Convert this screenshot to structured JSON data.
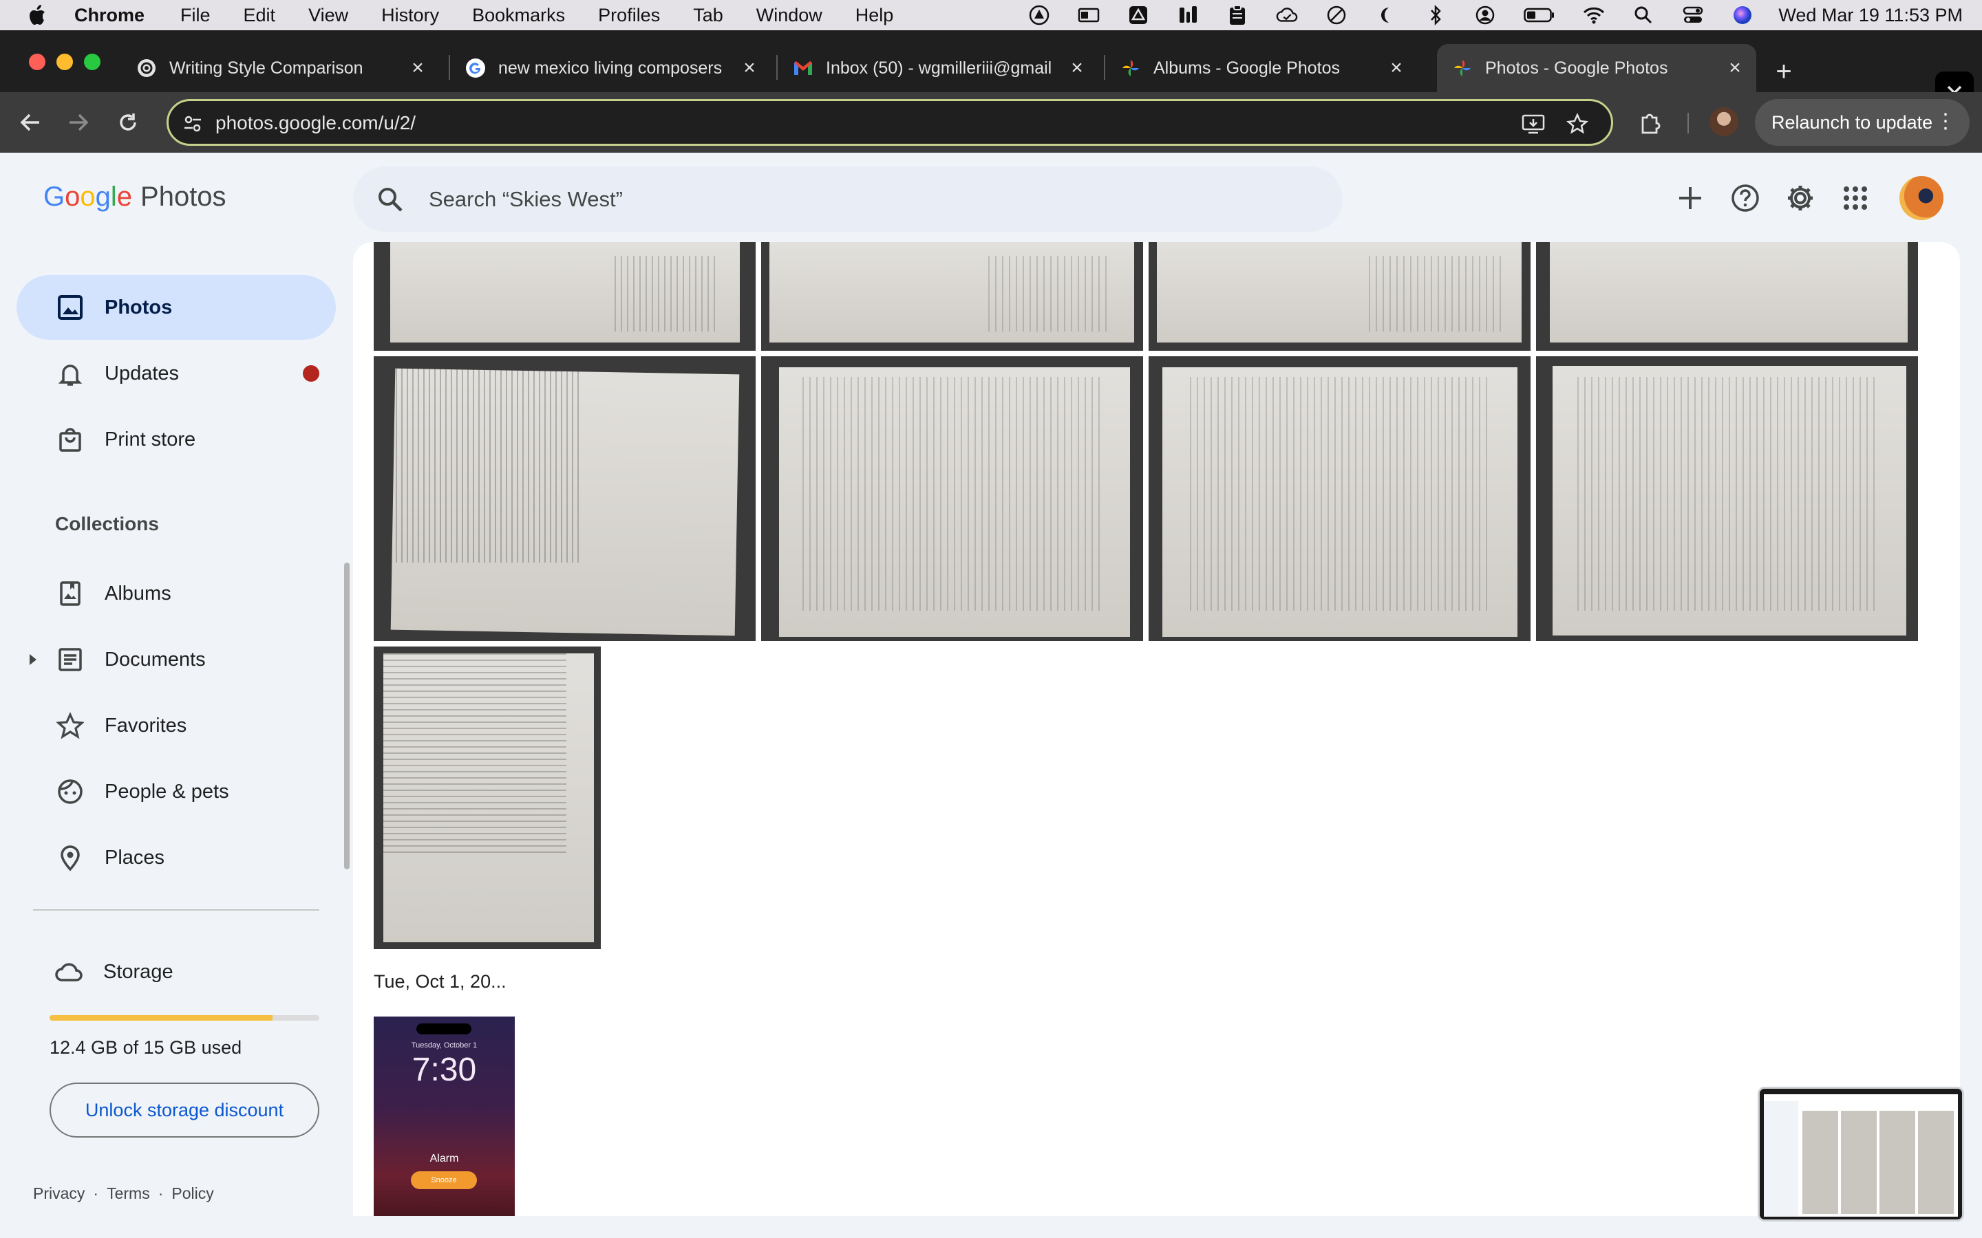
{
  "menubar": {
    "app_name": "Chrome",
    "items": [
      "File",
      "Edit",
      "View",
      "History",
      "Bookmarks",
      "Profiles",
      "Tab",
      "Window",
      "Help"
    ],
    "clock": "Wed Mar 19  11:53 PM"
  },
  "tabs": [
    {
      "title": "Writing Style Comparison",
      "icon": "chatgpt-icon"
    },
    {
      "title": "new mexico living composers",
      "icon": "google-g-icon"
    },
    {
      "title": "Inbox (50) - wgmilleriii@gmail",
      "icon": "gmail-icon"
    },
    {
      "title": "Albums - Google Photos",
      "icon": "google-photos-icon"
    },
    {
      "title": "Photos - Google Photos",
      "icon": "google-photos-icon",
      "active": true
    }
  ],
  "toolbar": {
    "url": "photos.google.com/u/2/",
    "relaunch_label": "Relaunch to update"
  },
  "app": {
    "logo_google": "Google",
    "logo_photos": "Photos",
    "search_placeholder": "Search “Skies West”"
  },
  "sidebar": {
    "items": [
      {
        "label": "Photos",
        "icon": "photo-icon",
        "active": true
      },
      {
        "label": "Updates",
        "icon": "bell-icon",
        "badge": true
      },
      {
        "label": "Print store",
        "icon": "shopping-bag-icon"
      }
    ],
    "collections_heading": "Collections",
    "collections": [
      {
        "label": "Albums",
        "icon": "album-icon"
      },
      {
        "label": "Documents",
        "icon": "document-icon",
        "expandable": true
      },
      {
        "label": "Favorites",
        "icon": "star-icon"
      },
      {
        "label": "People & pets",
        "icon": "face-icon"
      },
      {
        "label": "Places",
        "icon": "location-pin-icon"
      }
    ],
    "storage": {
      "label": "Storage",
      "used_text": "12.4 GB of 15 GB used",
      "used_fraction": 0.827,
      "unlock_label": "Unlock storage discount"
    },
    "footer": [
      "Privacy",
      "Terms",
      "Policy"
    ]
  },
  "main": {
    "date_heading": "Tue, Oct 1, 20...",
    "phone_photo": {
      "date": "Tuesday, October 1",
      "time": "7:30",
      "alarm": "Alarm",
      "snooze": "Snooze"
    }
  },
  "colors": {
    "accent_blue": "#0b57d0",
    "active_nav": "#d3e3fd",
    "badge_red": "#b3261e",
    "storage_fill": "#f4bf42"
  }
}
